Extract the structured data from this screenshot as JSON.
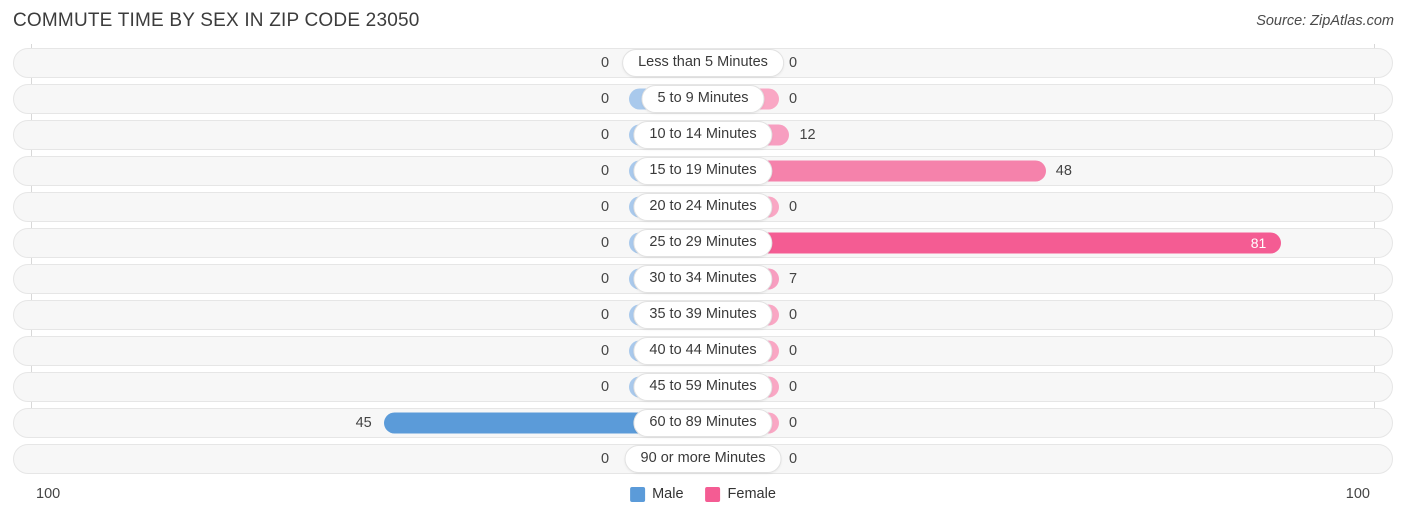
{
  "header": {
    "title": "COMMUTE TIME BY SEX IN ZIP CODE 23050",
    "source": "Source: ZipAtlas.com"
  },
  "legend": {
    "male_label": "Male",
    "female_label": "Female",
    "male_color": "#5b9bd9",
    "female_color": "#f45c93"
  },
  "axis": {
    "left_max": "100",
    "right_max": "100"
  },
  "chart_data": {
    "type": "bar",
    "orientation": "horizontal-diverging",
    "title": "COMMUTE TIME BY SEX IN ZIP CODE 23050",
    "xlabel": "",
    "ylabel": "",
    "xlim": [
      100,
      100
    ],
    "grid": false,
    "legend_position": "bottom-center",
    "categories": [
      "Less than 5 Minutes",
      "5 to 9 Minutes",
      "10 to 14 Minutes",
      "15 to 19 Minutes",
      "20 to 24 Minutes",
      "25 to 29 Minutes",
      "30 to 34 Minutes",
      "35 to 39 Minutes",
      "40 to 44 Minutes",
      "45 to 59 Minutes",
      "60 to 89 Minutes",
      "90 or more Minutes"
    ],
    "series": [
      {
        "name": "Male",
        "values": [
          0,
          0,
          0,
          0,
          0,
          0,
          0,
          0,
          0,
          0,
          45,
          0
        ],
        "labels": [
          "0",
          "0",
          "0",
          "0",
          "0",
          "0",
          "0",
          "0",
          "0",
          "0",
          "45",
          "0"
        ]
      },
      {
        "name": "Female",
        "values": [
          0,
          0,
          12,
          48,
          0,
          81,
          7,
          0,
          0,
          0,
          0,
          0
        ],
        "labels": [
          "0",
          "0",
          "12",
          "48",
          "0",
          "81",
          "7",
          "0",
          "0",
          "0",
          "0",
          "0"
        ]
      }
    ]
  }
}
